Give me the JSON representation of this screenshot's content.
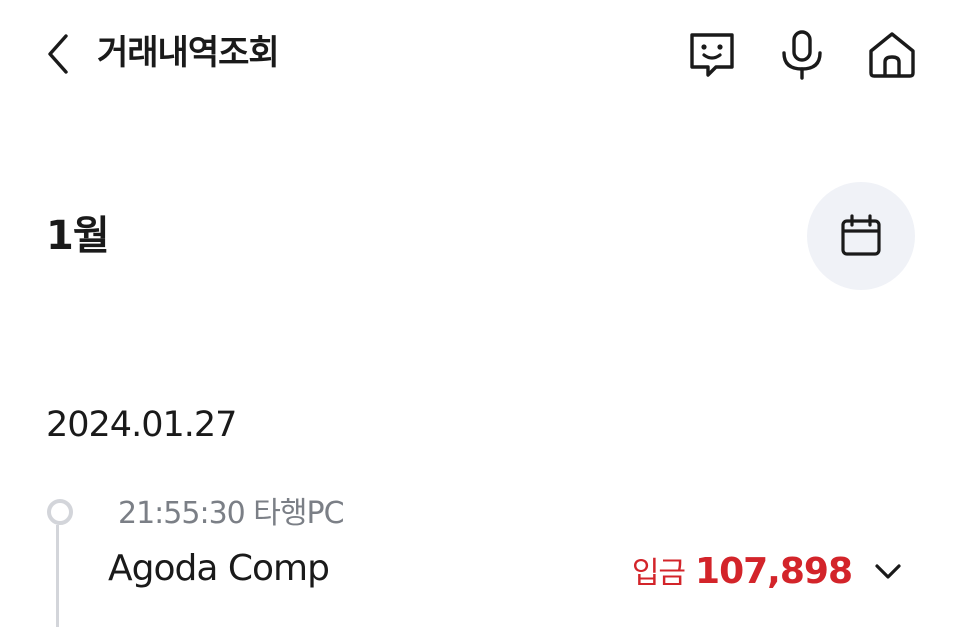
{
  "header": {
    "title": "거래내역조회",
    "back_icon": "chevron-left-icon",
    "actions": [
      {
        "name": "chatbot",
        "icon": "chat-bubble-smile-icon"
      },
      {
        "name": "voice",
        "icon": "microphone-icon"
      },
      {
        "name": "home",
        "icon": "home-icon"
      }
    ]
  },
  "month": {
    "label": "1월",
    "calendar_icon": "calendar-icon"
  },
  "transactions": {
    "date": "2024.01.27",
    "items": [
      {
        "time": "21:55:30",
        "memo": "타행PC",
        "meta": "21:55:30 타행PC",
        "name": "Agoda Comp",
        "type": "입금",
        "amount": "107,898",
        "expand_icon": "chevron-down-icon"
      }
    ]
  },
  "colors": {
    "accent_red": "#d3242a",
    "text_primary": "#1a1a1a",
    "text_secondary": "#7b7f86",
    "calendar_button_bg": "#f0f2f7",
    "timeline": "#d3d5da"
  }
}
